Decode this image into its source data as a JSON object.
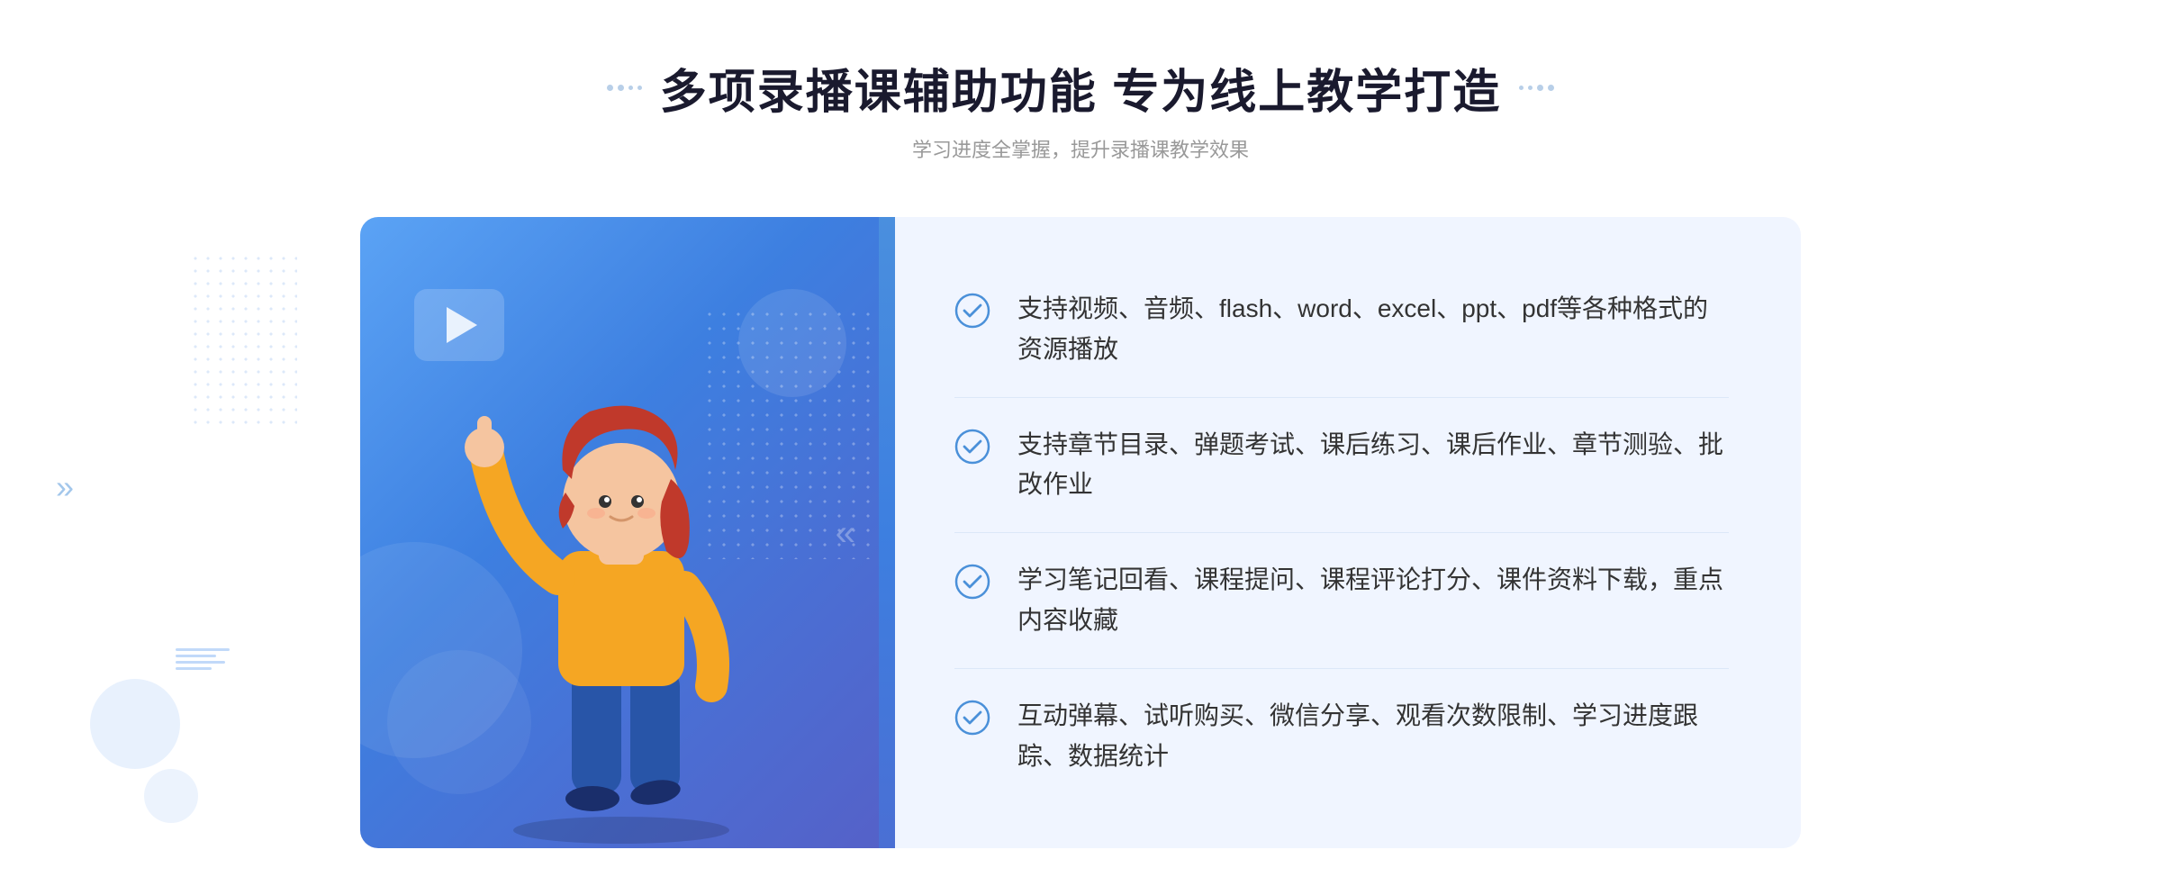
{
  "header": {
    "title": "多项录播课辅助功能 专为线上教学打造",
    "subtitle": "学习进度全掌握，提升录播课教学效果"
  },
  "features": [
    {
      "id": "feature-1",
      "text": "支持视频、音频、flash、word、excel、ppt、pdf等各种格式的资源播放"
    },
    {
      "id": "feature-2",
      "text": "支持章节目录、弹题考试、课后练习、课后作业、章节测验、批改作业"
    },
    {
      "id": "feature-3",
      "text": "学习笔记回看、课程提问、课程评论打分、课件资料下载，重点内容收藏"
    },
    {
      "id": "feature-4",
      "text": "互动弹幕、试听购买、微信分享、观看次数限制、学习进度跟踪、数据统计"
    }
  ],
  "icons": {
    "check": "check-circle-icon",
    "play": "play-icon",
    "chevron": "chevron-icon"
  },
  "colors": {
    "primary": "#3d7fe0",
    "accent": "#5ba3f5",
    "text_dark": "#1a1a2e",
    "text_gray": "#999999",
    "feature_text": "#333333",
    "bg_light": "#f0f5ff"
  }
}
